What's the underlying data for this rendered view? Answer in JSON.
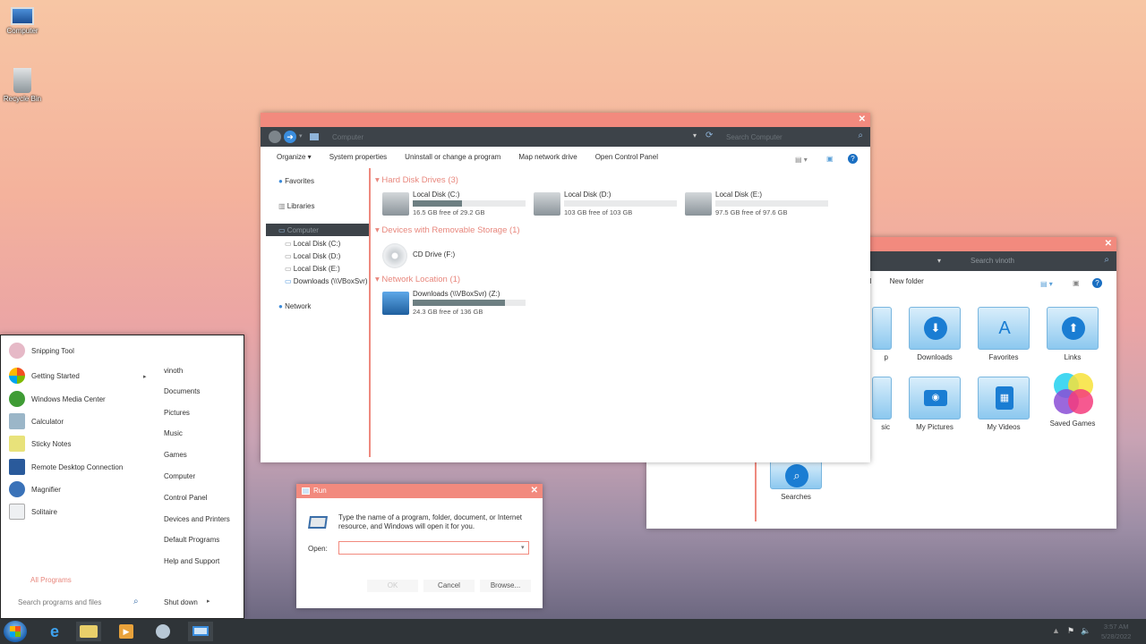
{
  "desktop": {
    "icons": [
      {
        "label": "Computer"
      },
      {
        "label": "Recycle Bin"
      }
    ]
  },
  "explorer": {
    "address": "Computer",
    "search_placeholder": "Search Computer",
    "toolbar": [
      "Organize ▾",
      "System properties",
      "Uninstall or change a program",
      "Map network drive",
      "Open Control Panel"
    ],
    "nav": {
      "favorites": "Favorites",
      "libraries": "Libraries",
      "computer": "Computer",
      "drives": [
        "Local Disk (C:)",
        "Local Disk (D:)",
        "Local Disk (E:)",
        "Downloads (\\\\VBoxSvr)"
      ],
      "network": "Network"
    },
    "groups": {
      "hdd": "Hard Disk Drives (3)",
      "removable": "Devices with Removable Storage (1)",
      "network": "Network Location (1)"
    },
    "drives": [
      {
        "name": "Local Disk (C:)",
        "free": "16.5 GB free of 29.2 GB",
        "used": 0.44
      },
      {
        "name": "Local Disk (D:)",
        "free": "103 GB free of 103 GB",
        "used": 0.0
      },
      {
        "name": "Local Disk (E:)",
        "free": "97.5 GB free of 97.6 GB",
        "used": 0.0
      }
    ],
    "cd": {
      "name": "CD Drive (F:)"
    },
    "netdrive": {
      "name": "Downloads (\\\\VBoxSvr) (Z:)",
      "free": "24.3 GB free of 136 GB",
      "used": 0.82
    }
  },
  "explorer2": {
    "search_placeholder": "Search vinoth",
    "toolbar_partial": "ll",
    "new_folder": "New folder",
    "folders": [
      {
        "label": "p"
      },
      {
        "label": "Downloads"
      },
      {
        "label": "Favorites"
      },
      {
        "label": "Links"
      },
      {
        "label": "sic"
      },
      {
        "label": "My Pictures"
      },
      {
        "label": "My Videos"
      },
      {
        "label": "Saved Games"
      },
      {
        "label": "Searches"
      }
    ]
  },
  "run": {
    "title": "Run",
    "description": "Type the name of a program, folder, document, or Internet resource, and Windows will open it for you.",
    "open_label": "Open:",
    "open_value": "",
    "ok": "OK",
    "cancel": "Cancel",
    "browse": "Browse..."
  },
  "startmenu": {
    "programs": [
      "Snipping Tool",
      "Getting Started",
      "Windows Media Center",
      "Calculator",
      "Sticky Notes",
      "Remote Desktop Connection",
      "Magnifier",
      "Solitaire"
    ],
    "all_programs": "All Programs",
    "search_placeholder": "Search programs and files",
    "right": [
      "vinoth",
      "Documents",
      "Pictures",
      "Music",
      "Games",
      "Computer",
      "Control Panel",
      "Devices and Printers",
      "Default Programs",
      "Help and Support"
    ],
    "shutdown": "Shut down"
  },
  "tray": {
    "time": "3:57 AM",
    "date": "5/28/2022"
  },
  "colors": {
    "accent": "#f28a7e",
    "nav": "#3d4349",
    "taskbar": "#2f3438",
    "folder": "#1a7dd3"
  }
}
